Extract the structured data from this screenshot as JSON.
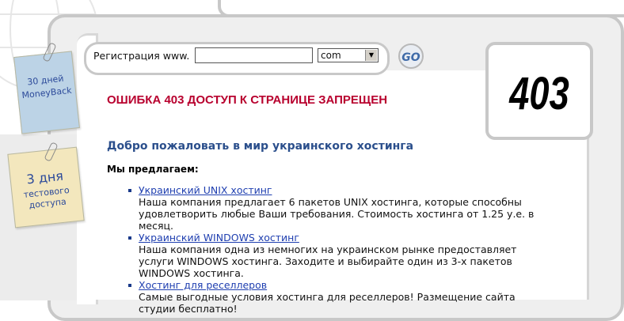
{
  "search": {
    "label": "Регистрация www.",
    "input_value": "",
    "tld_selected": "com",
    "go_label": "GO"
  },
  "error": {
    "code": "403",
    "title": "ОШИБКА 403 ДОСТУП К СТРАНИЦЕ ЗАПРЕЩЕН"
  },
  "notes": {
    "moneyback": {
      "line1": "30 дней",
      "line2": "MoneyBack"
    },
    "trial": {
      "line1": "3 дня",
      "line2": "тестового",
      "line3": "доступа"
    }
  },
  "content": {
    "welcome": "Добро пожаловать в мир украинского хостинга",
    "offer_label": "Мы предлагаем:",
    "items": [
      {
        "link": "Украинский UNIX хостинг",
        "desc": "Наша компания предлагает 6 пакетов UNIX хостинга, которые способны удовлетворить любые Ваши требования. Стоимость хостинга от 1.25 у.е. в месяц."
      },
      {
        "link": "Украинский WINDOWS хостинг",
        "desc": "Наша компания одна из немногих на украинском рынке предоставляет услуги WINDOWS хостинга. Заходите и выбирайте один из 3-х пакетов WINDOWS хостинга."
      },
      {
        "link": "Хостинг для реселлеров",
        "desc": "Самые выгодные условия хостинга для реселлеров! Размещение сайта студии бесплатно!"
      }
    ]
  },
  "colors": {
    "error_red": "#b8002e",
    "heading_blue": "#2b4f8c",
    "link_blue": "#1f3fb0",
    "frame_gray": "#c8c8c8"
  },
  "icons": {
    "globe": "globe-icon",
    "paperclip": "paperclip-icon",
    "dropdown": "chevron-down-icon"
  }
}
